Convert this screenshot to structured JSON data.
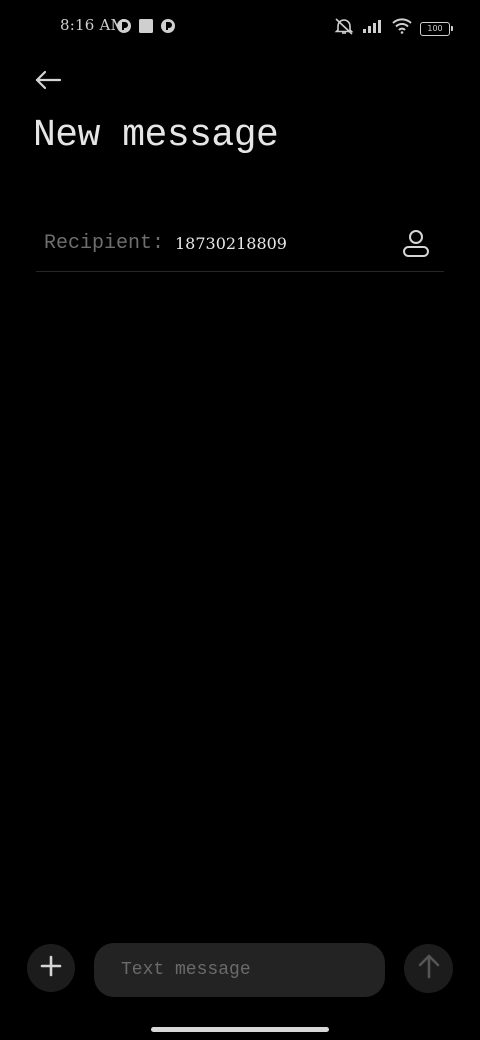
{
  "status_bar": {
    "time": "8:16 AM",
    "battery_level": "100",
    "left_icons": [
      "notification-app-icon",
      "square-notification-icon",
      "notification-app-icon"
    ],
    "right_icons": [
      "mute-icon",
      "signal-icon",
      "wifi-icon",
      "battery-icon"
    ]
  },
  "header": {
    "back_icon": "arrow-left-icon",
    "title": "New message"
  },
  "recipient": {
    "label": "Recipient:",
    "value": "18730218809",
    "contact_icon": "person-icon"
  },
  "compose": {
    "add_icon": "plus-icon",
    "placeholder": "Text message",
    "value": "",
    "send_icon": "arrow-up-icon"
  },
  "colors": {
    "background": "#000000",
    "input_background": "#232323",
    "button_background": "#1c1c1c",
    "label_gray": "#6e6e6e",
    "text_white": "#e8e8e8"
  }
}
